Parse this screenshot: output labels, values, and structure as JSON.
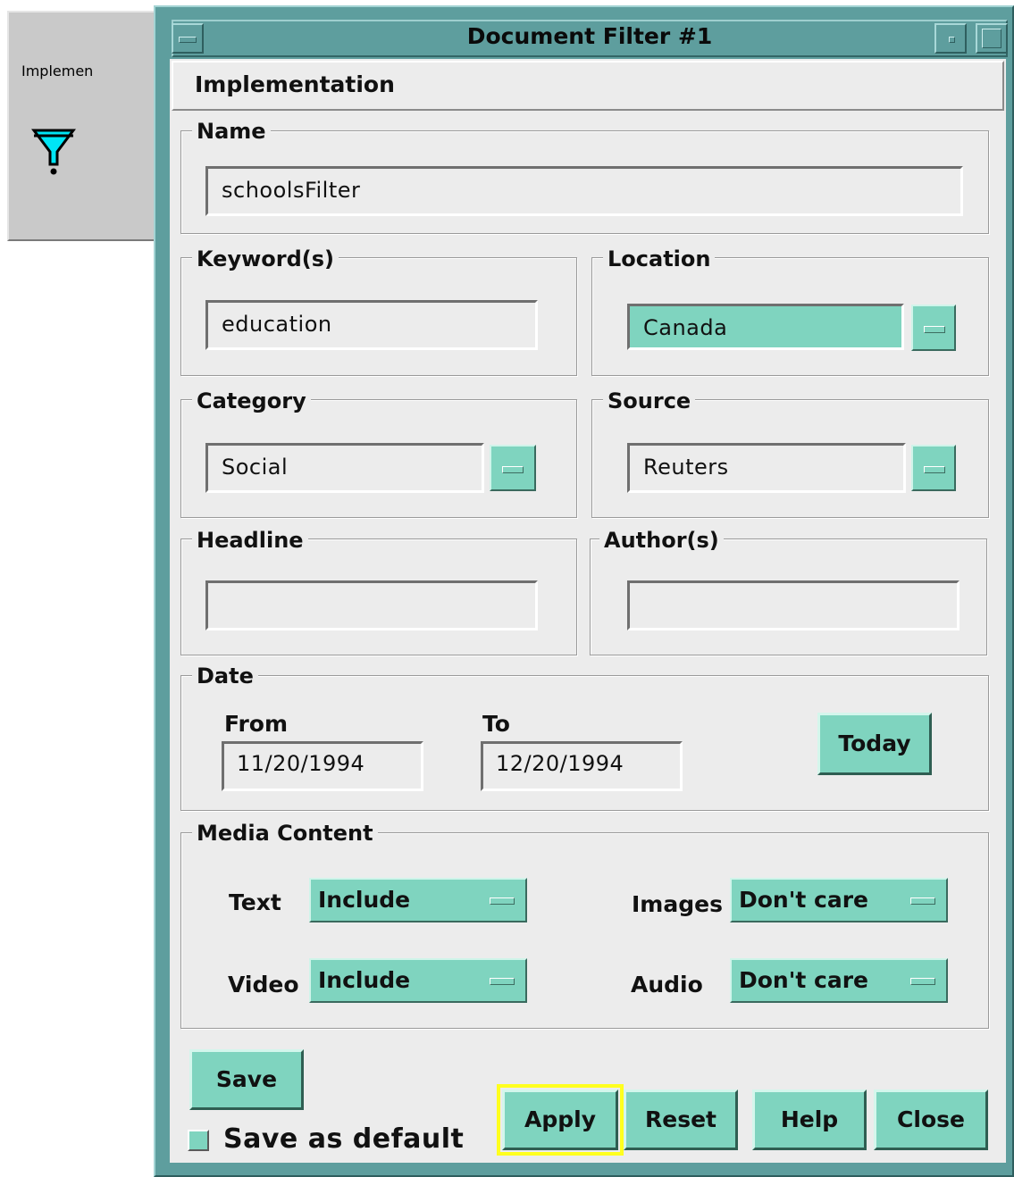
{
  "background_window": {
    "menu_label": "Implemen"
  },
  "window": {
    "title": "Document Filter #1"
  },
  "menubar": {
    "implementation": "Implementation"
  },
  "name": {
    "legend": "Name",
    "value": "schoolsFilter"
  },
  "keywords": {
    "legend": "Keyword(s)",
    "value": "education"
  },
  "location": {
    "legend": "Location",
    "value": "Canada"
  },
  "category": {
    "legend": "Category",
    "value": "Social"
  },
  "source": {
    "legend": "Source",
    "value": "Reuters"
  },
  "headline": {
    "legend": "Headline",
    "value": ""
  },
  "authors": {
    "legend": "Author(s)",
    "value": ""
  },
  "date": {
    "legend": "Date",
    "from_label": "From",
    "from_value": "11/20/1994",
    "to_label": "To",
    "to_value": "12/20/1994",
    "today_label": "Today"
  },
  "media": {
    "legend": "Media Content",
    "text_label": "Text",
    "text_value": "Include",
    "images_label": "Images",
    "images_value": "Don't care",
    "video_label": "Video",
    "video_value": "Include",
    "audio_label": "Audio",
    "audio_value": "Don't care"
  },
  "buttons": {
    "save": "Save",
    "save_default": "Save as default",
    "apply": "Apply",
    "reset": "Reset",
    "help": "Help",
    "close": "Close"
  },
  "colors": {
    "title_bar": "#5e9e9e",
    "panel": "#ececec",
    "button": "#7fd4bf",
    "focus_highlight": "#ffff1e",
    "funnel_icon": "#00e5f5"
  },
  "icons": {
    "background_window_icon": "filter-funnel-icon"
  }
}
